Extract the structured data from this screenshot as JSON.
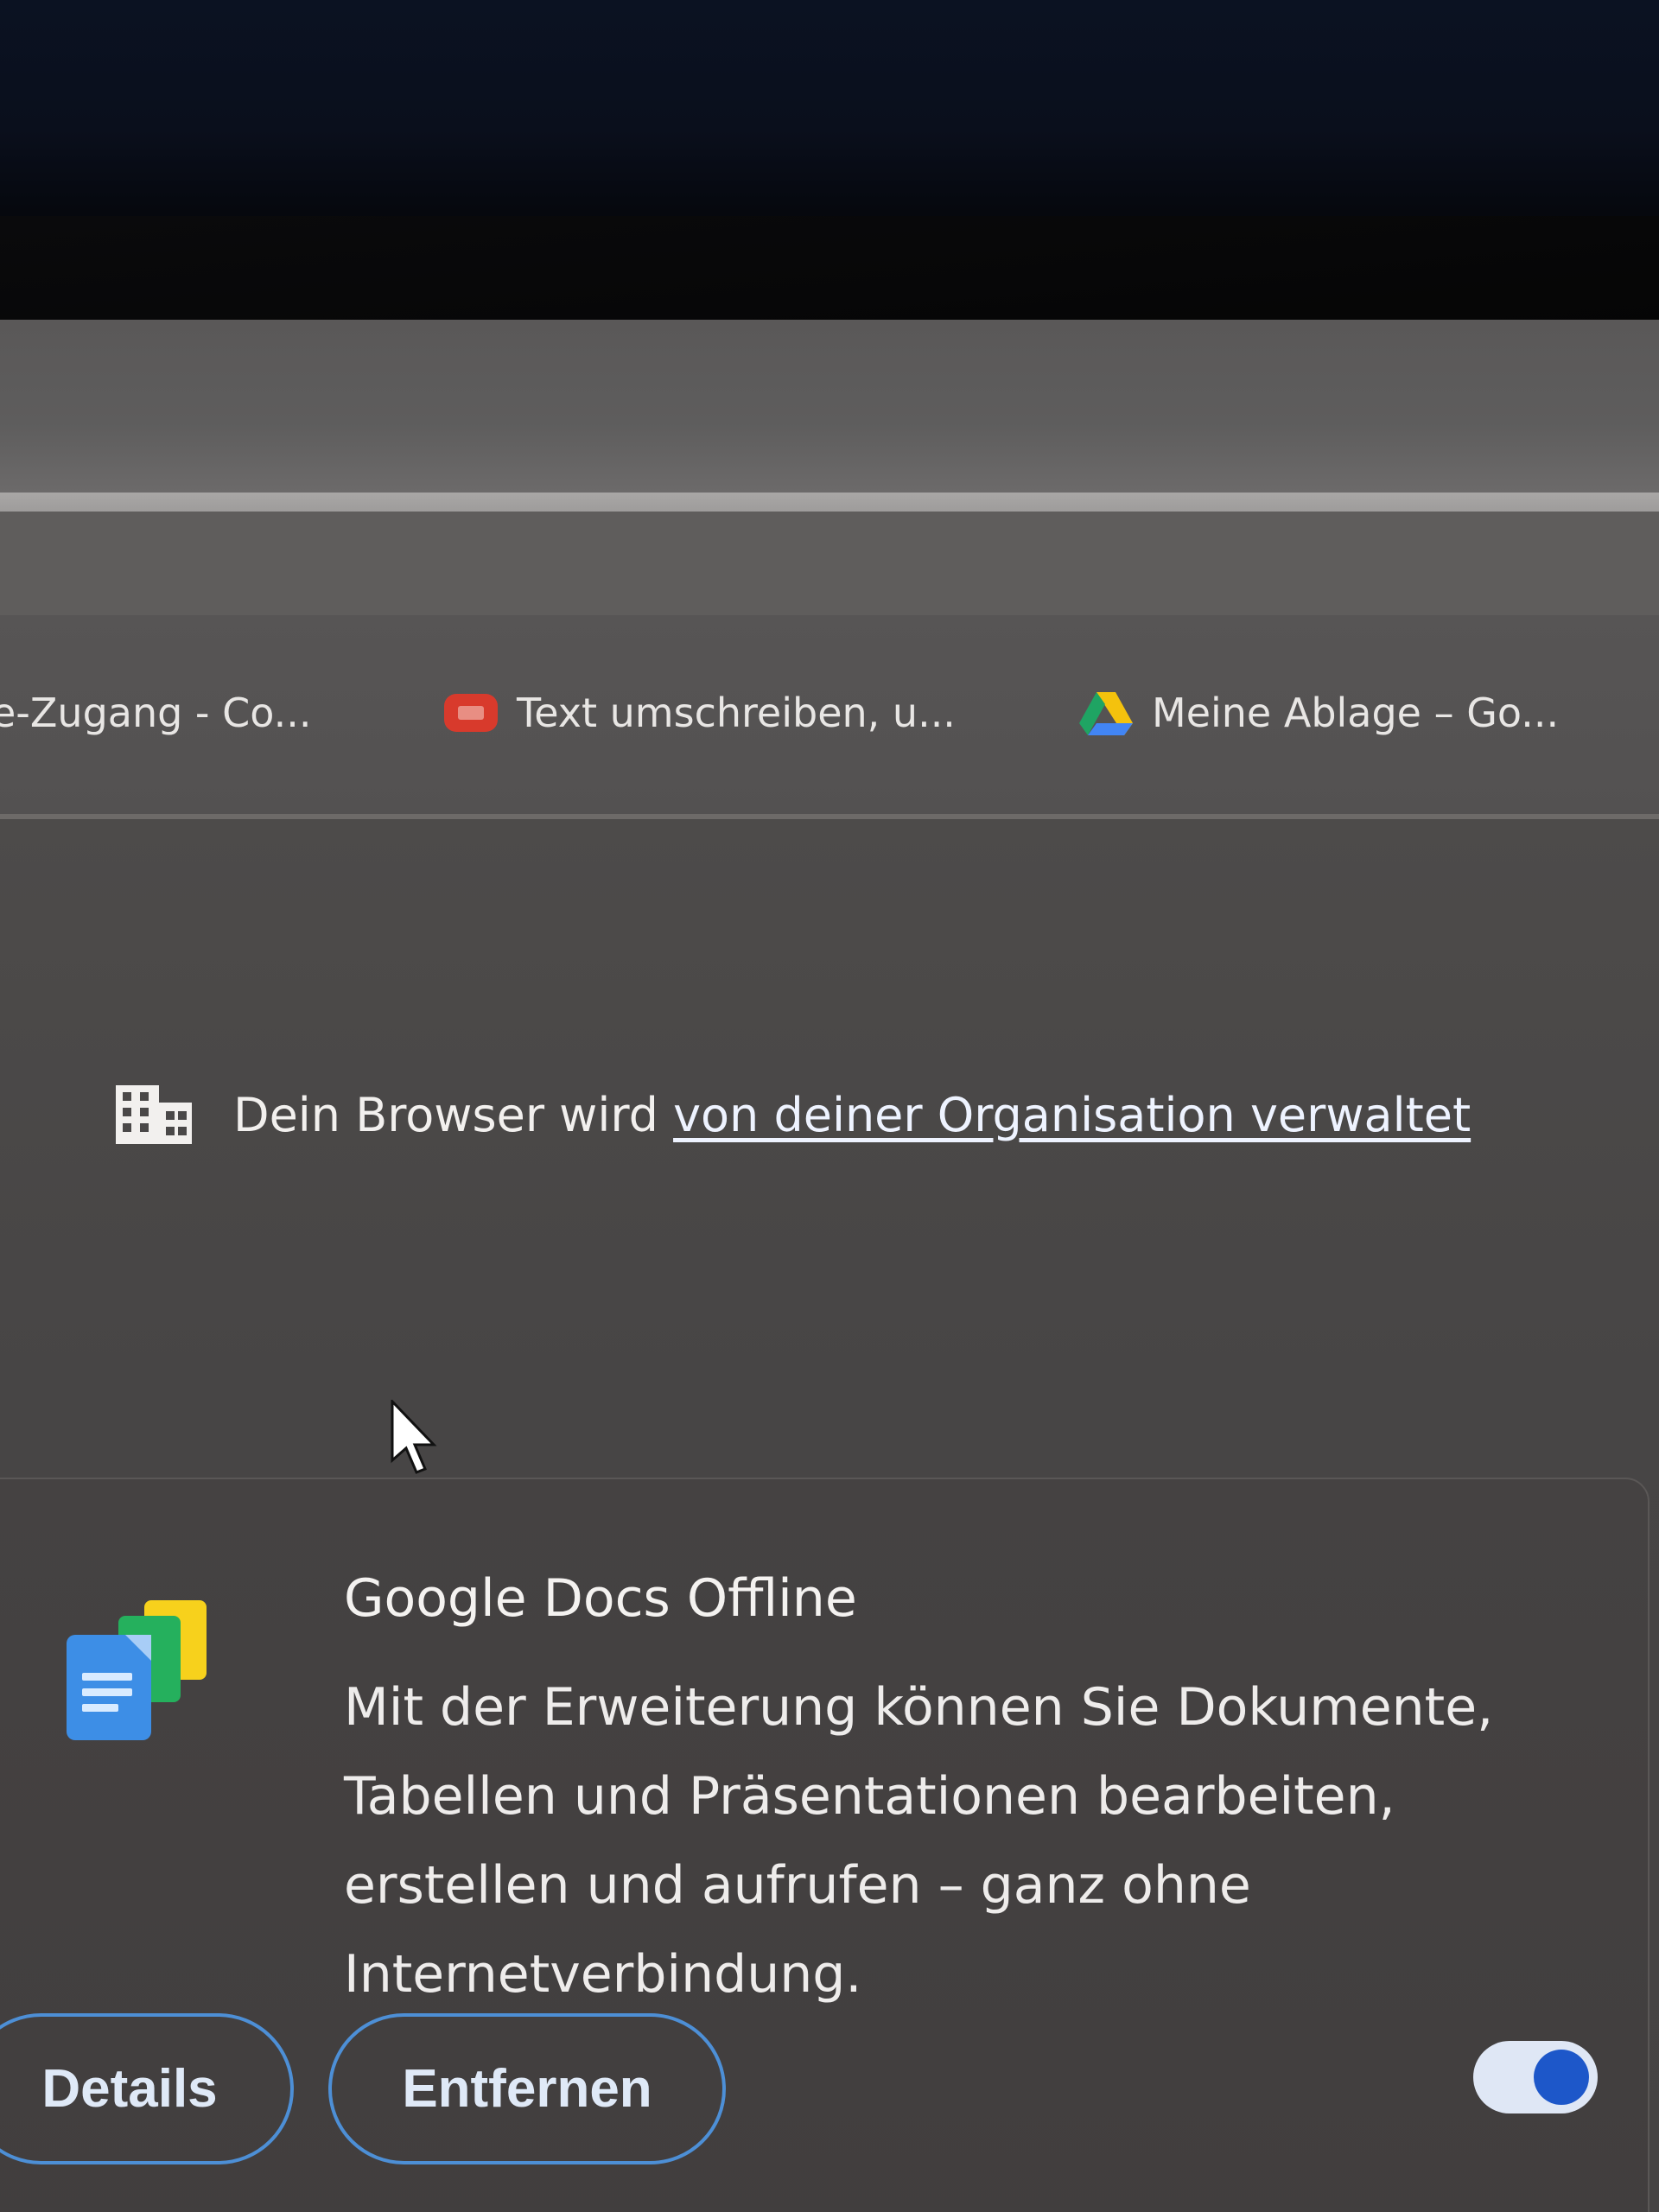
{
  "bookmarks": [
    {
      "label": "e-Zugang - Co...",
      "icon": "none"
    },
    {
      "label": "Text umschreiben, u...",
      "icon": "red-favicon-icon"
    },
    {
      "label": "Meine Ablage – Go...",
      "icon": "google-drive-icon"
    }
  ],
  "managed_notice": {
    "prefix": "Dein Browser wird",
    "link": "von deiner Organisation verwaltet",
    "icon": "building-icon"
  },
  "extension": {
    "name": "Google Docs Offline",
    "description": "Mit der Erweiterung können Sie Dokumente, Tabellen und Präsentationen bearbeiten, erstellen und aufrufen – ganz ohne Internetverbindung.",
    "icon": "google-docs-offline-icon",
    "details_label": "Details",
    "remove_label": "Entfernen",
    "enabled": true
  },
  "colors": {
    "accent": "#4d8fd6",
    "toggle_knob": "#1d57c9",
    "toggle_track": "#dfe7f5"
  }
}
